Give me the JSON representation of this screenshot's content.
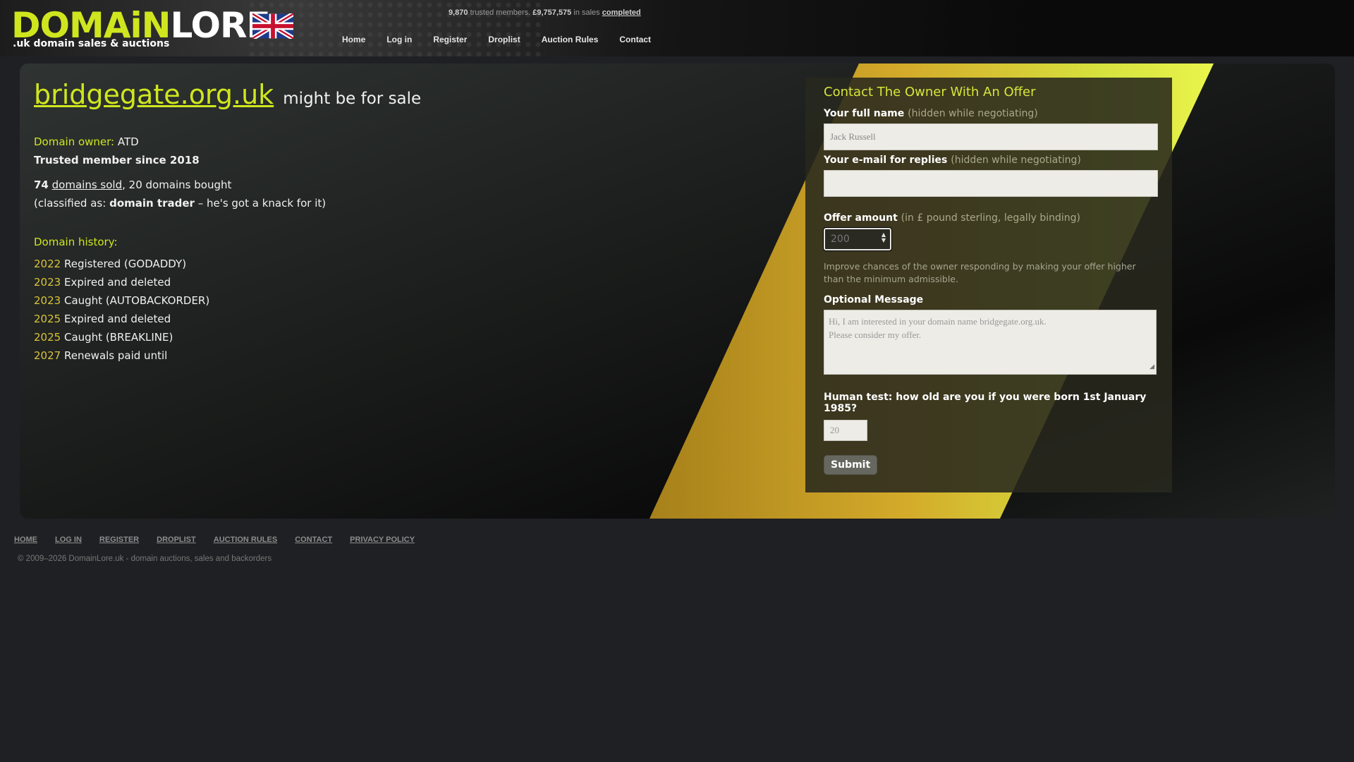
{
  "brand": {
    "logo_domain": "DOMAiN",
    "logo_lore": "LORE",
    "tagline": ".uk domain sales & auctions",
    "colors": {
      "lime": "#cfe61e",
      "gold": "#d9c23a"
    }
  },
  "stats": {
    "members": "9,870",
    "members_suffix": "trusted members.",
    "sales": "£9,757,575",
    "sales_suffix": "in sales",
    "link": "completed"
  },
  "nav": [
    "Home",
    "Log in",
    "Register",
    "Droplist",
    "Auction Rules",
    "Contact"
  ],
  "domain": {
    "name": "bridgegate.org.uk",
    "sale_text": "might be for sale",
    "owner_label": "Domain owner:",
    "owner": "ATD",
    "member_since": "Trusted member since 2018",
    "sold_count": "74",
    "sold_link": "domains sold",
    "bought_text": ", 20 domains bought",
    "classified_prefix": "(classified as:",
    "classification": "domain trader",
    "classified_suffix": "– he's got a knack for it)"
  },
  "history": {
    "heading": "Domain history:",
    "items": [
      {
        "year": "2022",
        "event": "Registered (GODADDY)"
      },
      {
        "year": "2023",
        "event": "Expired and deleted"
      },
      {
        "year": "2023",
        "event": "Caught (AUTOBACKORDER)"
      },
      {
        "year": "2025",
        "event": "Expired and deleted"
      },
      {
        "year": "2025",
        "event": "Caught (BREAKLINE)"
      },
      {
        "year": "2027",
        "event": "Renewals paid until"
      }
    ]
  },
  "form": {
    "title": "Contact The Owner With An Offer",
    "name_label": "Your full name",
    "name_hint": "(hidden while negotiating)",
    "name_placeholder": "Jack Russell",
    "email_label": "Your e-mail for replies",
    "email_hint": "(hidden while negotiating)",
    "email_value": "",
    "offer_label": "Offer amount",
    "offer_hint": "(in £ pound sterling, legally binding)",
    "offer_placeholder": "200",
    "improve_text": "Improve chances of the owner responding by making your offer higher than the minimum admissible.",
    "message_label": "Optional Message",
    "message_line1": "Hi, I am interested in your domain name bridgegate.org.uk.",
    "message_line2": "Please consider my offer.",
    "human_label": "Human test: how old are you if you were born 1st January 1985?",
    "human_placeholder": "20",
    "submit_label": "Submit"
  },
  "footer": {
    "links": [
      "HOME",
      "LOG IN",
      "REGISTER",
      "DROPLIST",
      "AUCTION RULES",
      "CONTACT",
      "PRIVACY POLICY"
    ],
    "copyright": "© 2009–2026 DomainLore.uk - domain auctions, sales and backorders"
  }
}
